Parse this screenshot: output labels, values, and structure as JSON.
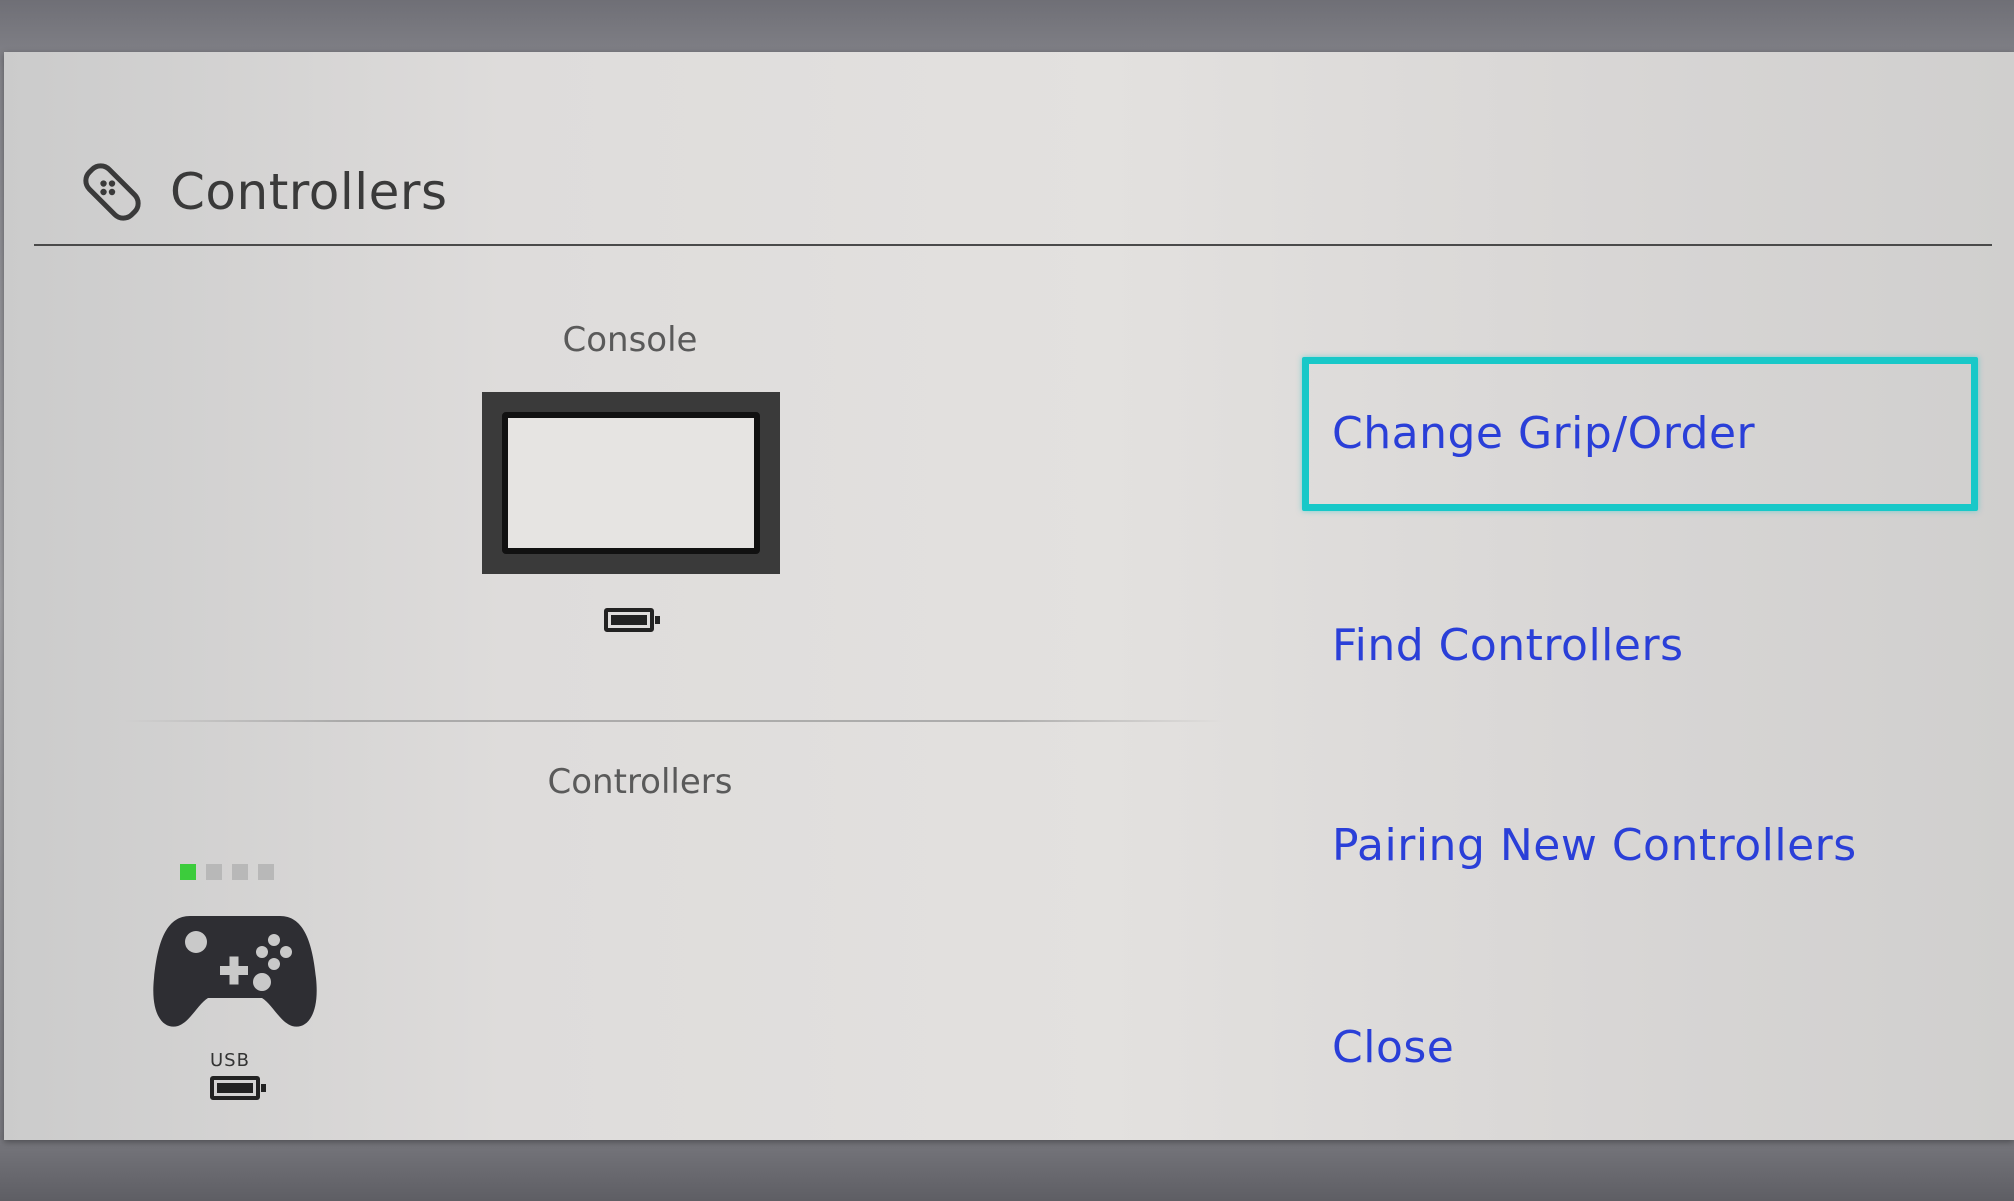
{
  "header": {
    "title": "Controllers",
    "icon": "joy-con-icon"
  },
  "console_section": {
    "label": "Console",
    "battery_icon": "battery-icon"
  },
  "controllers_section": {
    "label": "Controllers",
    "player_indicator": {
      "total": 4,
      "active": 1,
      "active_color": "#3ccc3c"
    },
    "controller_icon": "gamepad-icon",
    "connection_label": "USB",
    "battery_icon": "battery-icon"
  },
  "menu": {
    "items": [
      {
        "label": "Change Grip/Order",
        "selected": true
      },
      {
        "label": "Find Controllers"
      },
      {
        "label": "Pairing New Controllers"
      },
      {
        "label": "Close"
      }
    ],
    "highlight_color": "#18c8c8",
    "text_color": "#2a3fd8"
  }
}
